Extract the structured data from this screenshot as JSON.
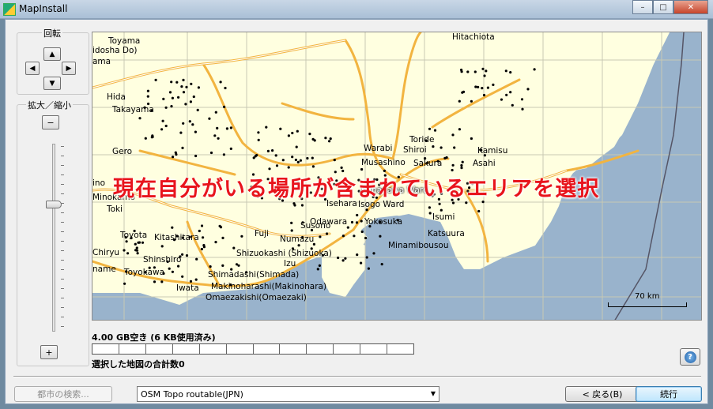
{
  "window": {
    "title": "MapInstall"
  },
  "controls": {
    "rotate_label": "回転",
    "zoom_label": "拡大／縮小",
    "zoom_out": "−",
    "zoom_in": "+"
  },
  "icons": {
    "up": "arrow-up-icon",
    "left": "arrow-left-icon",
    "right": "arrow-right-icon",
    "down": "arrow-down-icon",
    "help": "help-icon",
    "app": "app-icon"
  },
  "map": {
    "overlay_text": "現在自分がいる場所が含まれているエリアを選択",
    "scale_label": "70 km",
    "labels": [
      {
        "text": "Toyama",
        "dark": false
      },
      {
        "text": "idosha Do)",
        "dark": false
      },
      {
        "text": "ama",
        "dark": false
      },
      {
        "text": "Hida",
        "dark": false
      },
      {
        "text": "Takayama",
        "dark": false
      },
      {
        "text": "Gero",
        "dark": false
      },
      {
        "text": "ino",
        "dark": false
      },
      {
        "text": "Minokamo",
        "dark": false
      },
      {
        "text": "Toki",
        "dark": false
      },
      {
        "text": "Toyota",
        "dark": false
      },
      {
        "text": "Kitashitara",
        "dark": false
      },
      {
        "text": "Chiryu",
        "dark": false
      },
      {
        "text": "Shinshiro",
        "dark": false
      },
      {
        "text": "name",
        "dark": false
      },
      {
        "text": "Toyokawa",
        "dark": false
      },
      {
        "text": "Iwata",
        "dark": false
      },
      {
        "text": "Shimadashi(Shimada)",
        "dark": false
      },
      {
        "text": "Makinoharashi(Makinohara)",
        "dark": false
      },
      {
        "text": "Omaezakishi(Omaezaki)",
        "dark": false
      },
      {
        "text": "Shizuokashi (Shizuoka)",
        "dark": false
      },
      {
        "text": "Izu",
        "dark": false
      },
      {
        "text": "Fuji",
        "dark": false
      },
      {
        "text": "Numazu",
        "dark": false
      },
      {
        "text": "Susono",
        "dark": false
      },
      {
        "text": "Odawara",
        "dark": false
      },
      {
        "text": "Isehara",
        "dark": false
      },
      {
        "text": "Isogo Ward",
        "dark": false
      },
      {
        "text": "Yokosuka",
        "dark": false
      },
      {
        "text": "Minamibousou",
        "dark": false
      },
      {
        "text": "Katsuura",
        "dark": false
      },
      {
        "text": "Isumi",
        "dark": false
      },
      {
        "text": "Warabi",
        "dark": false
      },
      {
        "text": "Shiroi",
        "dark": false
      },
      {
        "text": "Musashino",
        "dark": false
      },
      {
        "text": "Sakura",
        "dark": false
      },
      {
        "text": "Toride",
        "dark": false
      },
      {
        "text": "Kamisu",
        "dark": false
      },
      {
        "text": "Asahi",
        "dark": false
      },
      {
        "text": "Hitachiota",
        "dark": false
      },
      {
        "text": "Kanagawa Ward",
        "dark": true
      }
    ]
  },
  "status": {
    "free_space": "4.00 GB空き (6 KB使用済み)",
    "total_selected": "選択した地図の合計数0"
  },
  "bottom": {
    "city_search": "都市の検索...",
    "map_select": "OSM Topo routable(JPN)",
    "back": "< 戻る(B)",
    "next": "続行"
  },
  "window_buttons": {
    "minimize": "–",
    "maximize": "□",
    "close": "✕"
  }
}
